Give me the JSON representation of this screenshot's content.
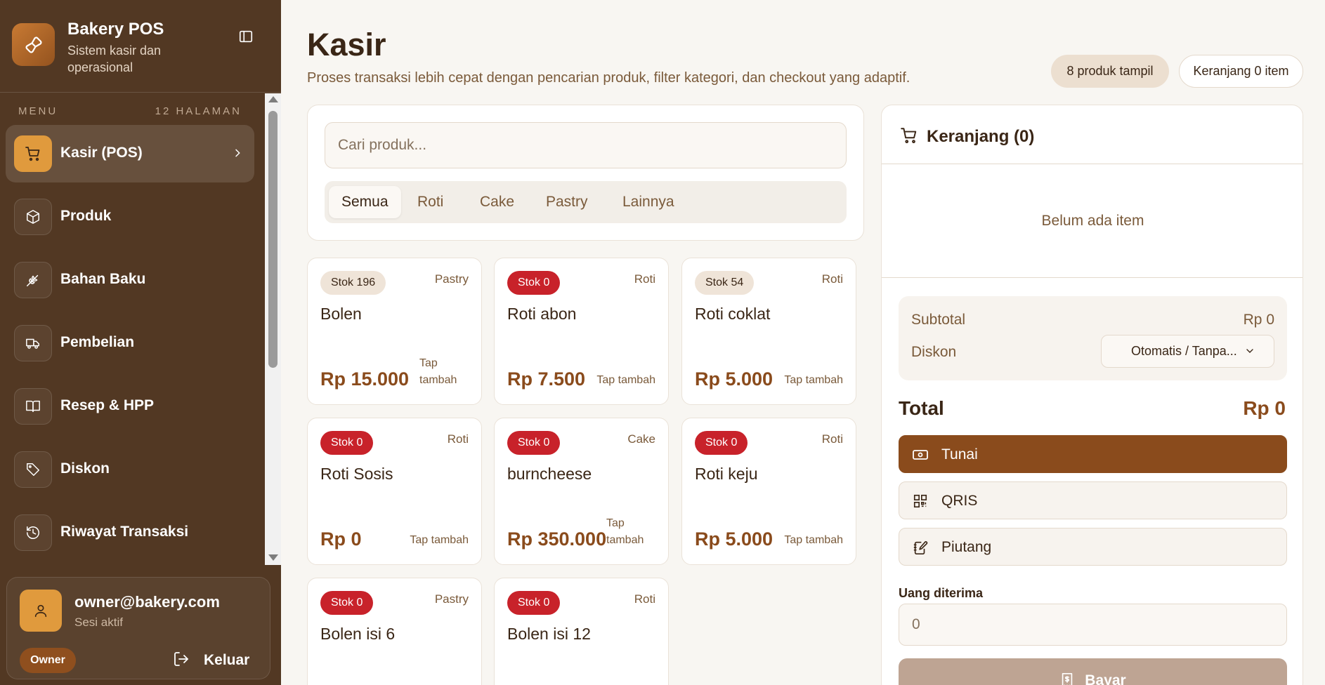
{
  "brand": {
    "name": "Bakery POS",
    "subtitle": "Sistem kasir dan operasional",
    "logo_icon": "croissant-icon",
    "collapse_icon": "sidebar-toggle-icon"
  },
  "nav": {
    "header_left": "MENU",
    "header_right": "12 HALAMAN",
    "items": [
      {
        "label": "Kasir (POS)",
        "icon": "shopping-cart-icon",
        "active": true
      },
      {
        "label": "Produk",
        "icon": "package-icon",
        "active": false
      },
      {
        "label": "Bahan Baku",
        "icon": "wheat-icon",
        "active": false
      },
      {
        "label": "Pembelian",
        "icon": "truck-icon",
        "active": false
      },
      {
        "label": "Resep & HPP",
        "icon": "book-icon",
        "active": false
      },
      {
        "label": "Diskon",
        "icon": "tag-icon",
        "active": false
      },
      {
        "label": "Riwayat Transaksi",
        "icon": "history-icon",
        "active": false
      }
    ]
  },
  "user": {
    "email": "owner@bakery.com",
    "status": "Sesi aktif",
    "role": "Owner",
    "logout_label": "Keluar"
  },
  "header": {
    "title": "Kasir",
    "subtitle": "Proses transaksi lebih cepat dengan pencarian produk, filter kategori, dan checkout yang adaptif.",
    "product_count": "8 produk tampil",
    "cart_count": "Keranjang 0 item"
  },
  "search": {
    "placeholder": "Cari produk...",
    "value": ""
  },
  "categories": [
    {
      "label": "Semua",
      "active": true
    },
    {
      "label": "Roti",
      "active": false
    },
    {
      "label": "Cake",
      "active": false
    },
    {
      "label": "Pastry",
      "active": false
    },
    {
      "label": "Lainnya",
      "active": false
    }
  ],
  "products": [
    {
      "stock": "Stok 196",
      "category": "Pastry",
      "name": "Bolen",
      "price": "Rp 15.000",
      "tap": "Tap tambah"
    },
    {
      "stock": "Stok 0",
      "category": "Roti",
      "name": "Roti abon",
      "price": "Rp 7.500",
      "tap": "Tap tambah"
    },
    {
      "stock": "Stok 54",
      "category": "Roti",
      "name": "Roti coklat",
      "price": "Rp 5.000",
      "tap": "Tap tambah"
    },
    {
      "stock": "Stok 0",
      "category": "Roti",
      "name": "Roti Sosis",
      "price": "Rp 0",
      "tap": "Tap tambah"
    },
    {
      "stock": "Stok 0",
      "category": "Cake",
      "name": "burncheese",
      "price": "Rp 350.000",
      "tap": "Tap tambah"
    },
    {
      "stock": "Stok 0",
      "category": "Roti",
      "name": "Roti keju",
      "price": "Rp 5.000",
      "tap": "Tap tambah"
    },
    {
      "stock": "Stok 0",
      "category": "Pastry",
      "name": "Bolen isi 6",
      "price": "",
      "tap": ""
    },
    {
      "stock": "Stok 0",
      "category": "Roti",
      "name": "Bolen isi 12",
      "price": "",
      "tap": ""
    }
  ],
  "cart": {
    "title": "Keranjang (0)",
    "empty_text": "Belum ada item",
    "subtotal_label": "Subtotal",
    "subtotal_value": "Rp 0",
    "discount_label": "Diskon",
    "discount_selected": "Otomatis / Tanpa...",
    "total_label": "Total",
    "total_value": "Rp 0",
    "payment_methods": [
      {
        "label": "Tunai",
        "icon": "banknote-icon",
        "active": true
      },
      {
        "label": "QRIS",
        "icon": "qr-code-icon",
        "active": false
      },
      {
        "label": "Piutang",
        "icon": "notebook-pen-icon",
        "active": false
      }
    ],
    "cash_label": "Uang diterima",
    "cash_placeholder": "0",
    "pay_label": "Bayar",
    "pay_icon": "receipt-icon"
  },
  "colors": {
    "sidebar_bg": "#523823",
    "accent": "#e09a3d",
    "brand_brown": "#8a4b1c",
    "stock_out_red": "#c8222a",
    "page_bg": "#f8f6f2"
  }
}
